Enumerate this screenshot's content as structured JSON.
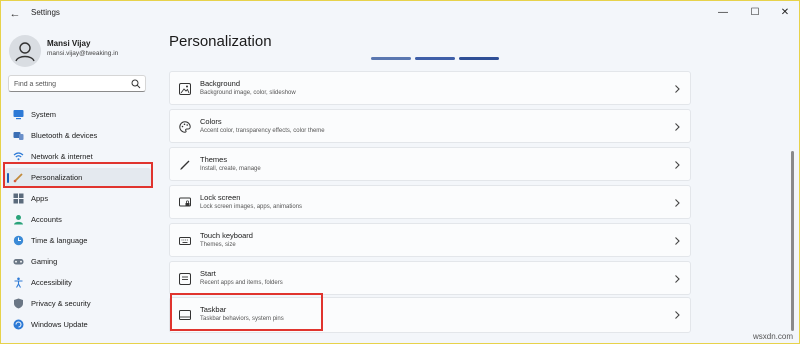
{
  "window": {
    "title": "Settings",
    "back_icon": "back-arrow-icon",
    "controls": {
      "minimize": "—",
      "maximize": "☐",
      "close": "✕"
    }
  },
  "user": {
    "name": "Mansi Vijay",
    "email": "mansi.vijay@tweaking.in"
  },
  "search": {
    "placeholder": "Find a setting",
    "icon": "search-icon"
  },
  "sidebar": {
    "items": [
      {
        "label": "System",
        "icon": "system-icon",
        "active": false
      },
      {
        "label": "Bluetooth & devices",
        "icon": "bluetooth-icon",
        "active": false
      },
      {
        "label": "Network & internet",
        "icon": "wifi-icon",
        "active": false
      },
      {
        "label": "Personalization",
        "icon": "brush-icon",
        "active": true
      },
      {
        "label": "Apps",
        "icon": "apps-icon",
        "active": false
      },
      {
        "label": "Accounts",
        "icon": "accounts-icon",
        "active": false
      },
      {
        "label": "Time & language",
        "icon": "globe-clock-icon",
        "active": false
      },
      {
        "label": "Gaming",
        "icon": "gaming-icon",
        "active": false
      },
      {
        "label": "Accessibility",
        "icon": "accessibility-icon",
        "active": false
      },
      {
        "label": "Privacy & security",
        "icon": "shield-icon",
        "active": false
      },
      {
        "label": "Windows Update",
        "icon": "update-icon",
        "active": false
      }
    ]
  },
  "main": {
    "title": "Personalization",
    "cards": [
      {
        "title": "Background",
        "subtitle": "Background image, color, slideshow",
        "icon": "image-icon"
      },
      {
        "title": "Colors",
        "subtitle": "Accent color, transparency effects, color theme",
        "icon": "palette-icon"
      },
      {
        "title": "Themes",
        "subtitle": "Install, create, manage",
        "icon": "brush-icon"
      },
      {
        "title": "Lock screen",
        "subtitle": "Lock screen images, apps, animations",
        "icon": "lock-screen-icon"
      },
      {
        "title": "Touch keyboard",
        "subtitle": "Themes, size",
        "icon": "keyboard-icon"
      },
      {
        "title": "Start",
        "subtitle": "Recent apps and items, folders",
        "icon": "start-icon"
      },
      {
        "title": "Taskbar",
        "subtitle": "Taskbar behaviors, system pins",
        "icon": "taskbar-icon"
      }
    ]
  },
  "colors": {
    "accent": "#1b5fb8",
    "highlight_box": "#e0342e"
  },
  "watermark": "wsxdn.com"
}
